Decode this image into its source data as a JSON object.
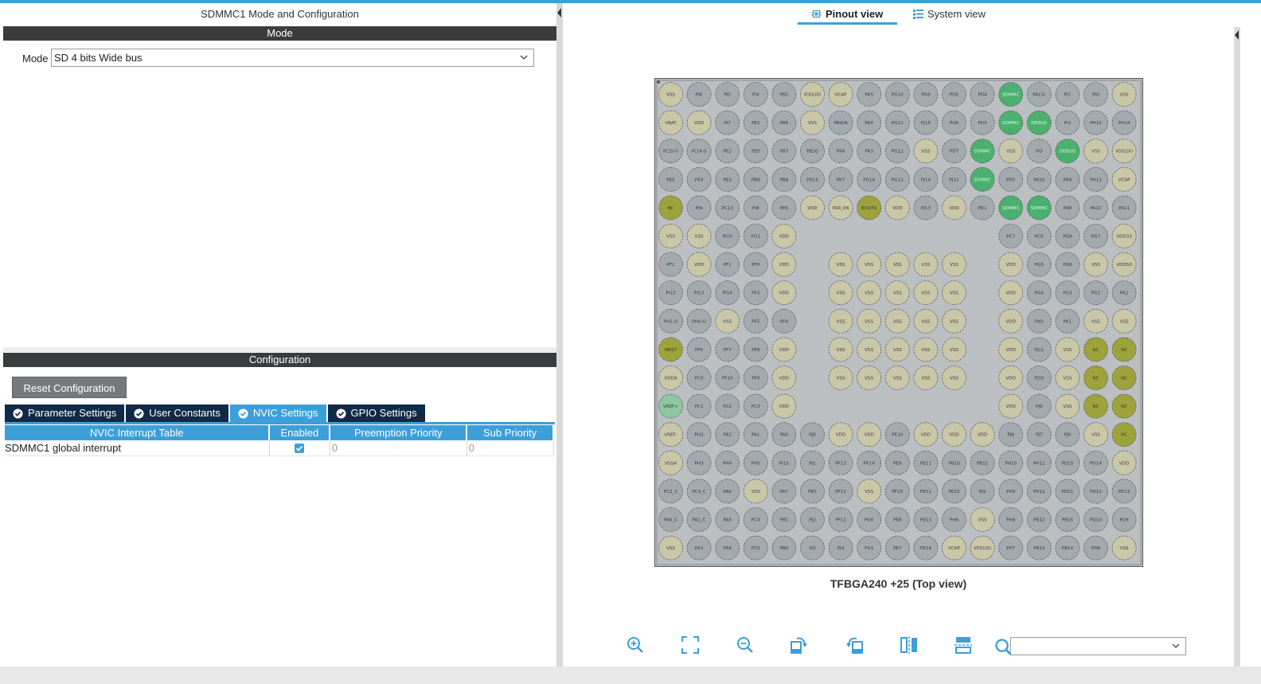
{
  "left_panel": {
    "title": "SDMMC1 Mode and Configuration",
    "mode_section": {
      "header": "Mode",
      "mode_label": "Mode",
      "mode_value": "SD 4 bits Wide bus"
    },
    "config_section": {
      "header": "Configuration",
      "reset_button": "Reset Configuration",
      "tabs": [
        {
          "label": "Parameter Settings",
          "active": false
        },
        {
          "label": "User Constants",
          "active": false
        },
        {
          "label": "NVIC Settings",
          "active": true
        },
        {
          "label": "GPIO Settings",
          "active": false
        }
      ],
      "nvic_table": {
        "columns": [
          "NVIC Interrupt Table",
          "Enabled",
          "Preemption Priority",
          "Sub Priority"
        ],
        "rows": [
          {
            "name": "SDMMC1 global interrupt",
            "enabled": true,
            "preemption": "0",
            "sub": "0"
          }
        ]
      }
    }
  },
  "right_panel": {
    "view_tabs": [
      {
        "label": "Pinout view",
        "active": true,
        "icon": "chip-icon"
      },
      {
        "label": "System view",
        "active": false,
        "icon": "list-icon"
      }
    ],
    "package_label": "TFBGA240 +25 (Top view)",
    "pin_colors": {
      "gray": "#a4a9ad",
      "power": "#c9c7a7",
      "green": "#4bb06f",
      "olive": "#9ea23a",
      "light_green": "#8fc6a0"
    },
    "pin_grid": [
      [
        [
          "VSS",
          "power"
        ],
        [
          "PI6",
          "gray"
        ],
        [
          "PI5",
          "gray"
        ],
        [
          "PI4",
          "gray"
        ],
        [
          "PB5",
          "gray"
        ],
        [
          "VDDLDO",
          "power"
        ],
        [
          "VCAP",
          "power"
        ],
        [
          "PK5",
          "gray"
        ],
        [
          "PG10",
          "gray"
        ],
        [
          "PG9",
          "gray"
        ],
        [
          "PD5",
          "gray"
        ],
        [
          "PD4",
          "gray"
        ],
        [
          "SDMMC",
          "green"
        ],
        [
          "PA15(",
          "gray"
        ],
        [
          "PI1",
          "gray"
        ],
        [
          "PI0",
          "gray"
        ],
        [
          "VSS",
          "power"
        ]
      ],
      [
        [
          "VBAT",
          "power"
        ],
        [
          "VDD",
          "power"
        ],
        [
          "PI7",
          "gray"
        ],
        [
          "PE1",
          "gray"
        ],
        [
          "PB6",
          "gray"
        ],
        [
          "VSS",
          "power"
        ],
        [
          "PB4(N",
          "gray"
        ],
        [
          "PK4",
          "gray"
        ],
        [
          "PG11",
          "gray"
        ],
        [
          "PJ15",
          "gray"
        ],
        [
          "PD6",
          "gray"
        ],
        [
          "PD3",
          "gray"
        ],
        [
          "SDMMC",
          "green"
        ],
        [
          "DEBUG",
          "green"
        ],
        [
          "PI2",
          "gray"
        ],
        [
          "PH15",
          "gray"
        ],
        [
          "PH14",
          "gray"
        ]
      ],
      [
        [
          "PC15-O",
          "gray"
        ],
        [
          "PC14-O",
          "gray"
        ],
        [
          "PE2",
          "gray"
        ],
        [
          "PE0",
          "gray"
        ],
        [
          "PB7",
          "gray"
        ],
        [
          "PB3(J",
          "gray"
        ],
        [
          "PK6",
          "gray"
        ],
        [
          "PK3",
          "gray"
        ],
        [
          "PG12",
          "gray"
        ],
        [
          "VSS",
          "power"
        ],
        [
          "PD7",
          "gray"
        ],
        [
          "SDMMC",
          "green"
        ],
        [
          "VSS",
          "power"
        ],
        [
          "PI3",
          "gray"
        ],
        [
          "DEBUG",
          "green"
        ],
        [
          "VSS",
          "power"
        ],
        [
          "VDDLDO",
          "power"
        ]
      ],
      [
        [
          "PE5",
          "gray"
        ],
        [
          "PE4",
          "gray"
        ],
        [
          "PE3",
          "gray"
        ],
        [
          "PB9",
          "gray"
        ],
        [
          "PB8",
          "gray"
        ],
        [
          "PG15",
          "gray"
        ],
        [
          "PK7",
          "gray"
        ],
        [
          "PG14",
          "gray"
        ],
        [
          "PG13",
          "gray"
        ],
        [
          "PJ14",
          "gray"
        ],
        [
          "PJ12",
          "gray"
        ],
        [
          "SDMMC",
          "green"
        ],
        [
          "PD0",
          "gray"
        ],
        [
          "PA10",
          "gray"
        ],
        [
          "PA9",
          "gray"
        ],
        [
          "PH13",
          "gray"
        ],
        [
          "VCAP",
          "power"
        ]
      ],
      [
        [
          "NC",
          "olive"
        ],
        [
          "PI9",
          "gray"
        ],
        [
          "PC13",
          "gray"
        ],
        [
          "PI8",
          "gray"
        ],
        [
          "PE6",
          "gray"
        ],
        [
          "VDD",
          "power"
        ],
        [
          "PDR_ON",
          "power"
        ],
        [
          "BOOT0",
          "olive"
        ],
        [
          "VDD",
          "power"
        ],
        [
          "PJ13",
          "gray"
        ],
        [
          "VDD",
          "power"
        ],
        [
          "PD1",
          "gray"
        ],
        [
          "SDMMC",
          "green"
        ],
        [
          "SDMMC",
          "green"
        ],
        [
          "PA8",
          "gray"
        ],
        [
          "PA12",
          "gray"
        ],
        [
          "PA11",
          "gray"
        ]
      ],
      [
        [
          "VSS",
          "power"
        ],
        [
          "VSS",
          "power"
        ],
        [
          "PI10",
          "gray"
        ],
        [
          "PI11",
          "gray"
        ],
        [
          "VDD",
          "power"
        ],
        null,
        null,
        null,
        null,
        null,
        null,
        null,
        [
          "PC7",
          "gray"
        ],
        [
          "PC6",
          "gray"
        ],
        [
          "PG8",
          "gray"
        ],
        [
          "PG7",
          "gray"
        ],
        [
          "VDD33",
          "power"
        ]
      ],
      [
        [
          "PF2",
          "gray"
        ],
        [
          "VDD",
          "power"
        ],
        [
          "PF1",
          "gray"
        ],
        [
          "PF0",
          "gray"
        ],
        [
          "VDD",
          "power"
        ],
        null,
        [
          "VSS",
          "power"
        ],
        [
          "VSS",
          "power"
        ],
        [
          "VSS",
          "power"
        ],
        [
          "VSS",
          "power"
        ],
        [
          "VSS",
          "power"
        ],
        null,
        [
          "VDD",
          "power"
        ],
        [
          "PG5",
          "gray"
        ],
        [
          "PG6",
          "gray"
        ],
        [
          "VSS",
          "power"
        ],
        [
          "VDD50",
          "power"
        ]
      ],
      [
        [
          "PI12",
          "gray"
        ],
        [
          "PI13",
          "gray"
        ],
        [
          "PI14",
          "gray"
        ],
        [
          "PF3",
          "gray"
        ],
        [
          "VDD",
          "power"
        ],
        null,
        [
          "VSS",
          "power"
        ],
        [
          "VSS",
          "power"
        ],
        [
          "VSS",
          "power"
        ],
        [
          "VSS",
          "power"
        ],
        [
          "VSS",
          "power"
        ],
        null,
        [
          "VDD",
          "power"
        ],
        [
          "PG4",
          "gray"
        ],
        [
          "PG3",
          "gray"
        ],
        [
          "PG2",
          "gray"
        ],
        [
          "PK2",
          "gray"
        ]
      ],
      [
        [
          "PH1-O",
          "gray"
        ],
        [
          "PH0-O",
          "gray"
        ],
        [
          "VSS",
          "power"
        ],
        [
          "PF5",
          "gray"
        ],
        [
          "PF4",
          "gray"
        ],
        null,
        [
          "VSS",
          "power"
        ],
        [
          "VSS",
          "power"
        ],
        [
          "VSS",
          "power"
        ],
        [
          "VSS",
          "power"
        ],
        [
          "VSS",
          "power"
        ],
        null,
        [
          "VDD",
          "power"
        ],
        [
          "PK0",
          "gray"
        ],
        [
          "PK1",
          "gray"
        ],
        [
          "VSS",
          "power"
        ],
        [
          "VSS",
          "power"
        ]
      ],
      [
        [
          "NRST",
          "olive"
        ],
        [
          "PF6",
          "gray"
        ],
        [
          "PF7",
          "gray"
        ],
        [
          "PF8",
          "gray"
        ],
        [
          "VDD",
          "power"
        ],
        null,
        [
          "VSS",
          "power"
        ],
        [
          "VSS",
          "power"
        ],
        [
          "VSS",
          "power"
        ],
        [
          "VSS",
          "power"
        ],
        [
          "VSS",
          "power"
        ],
        null,
        [
          "VDD",
          "power"
        ],
        [
          "PJ11",
          "gray"
        ],
        [
          "VSS",
          "power"
        ],
        [
          "NC",
          "olive"
        ],
        [
          "NC",
          "olive"
        ]
      ],
      [
        [
          "VDDA",
          "power"
        ],
        [
          "PC0",
          "gray"
        ],
        [
          "PF10",
          "gray"
        ],
        [
          "PF9",
          "gray"
        ],
        [
          "VDD",
          "power"
        ],
        null,
        [
          "VSS",
          "power"
        ],
        [
          "VSS",
          "power"
        ],
        [
          "VSS",
          "power"
        ],
        [
          "VSS",
          "power"
        ],
        [
          "VSS",
          "power"
        ],
        null,
        [
          "VDD",
          "power"
        ],
        [
          "PJ10",
          "gray"
        ],
        [
          "VSS",
          "power"
        ],
        [
          "NC",
          "olive"
        ],
        [
          "NC",
          "olive"
        ]
      ],
      [
        [
          "VREF+",
          "light_green"
        ],
        [
          "PC1",
          "gray"
        ],
        [
          "PC2",
          "gray"
        ],
        [
          "PC3",
          "gray"
        ],
        [
          "VDD",
          "power"
        ],
        null,
        null,
        null,
        null,
        null,
        null,
        null,
        [
          "VDD",
          "power"
        ],
        [
          "PJ9",
          "gray"
        ],
        [
          "VSS",
          "power"
        ],
        [
          "NC",
          "olive"
        ],
        [
          "NC",
          "olive"
        ]
      ],
      [
        [
          "VREF-",
          "power"
        ],
        [
          "PH2",
          "gray"
        ],
        [
          "PA2",
          "gray"
        ],
        [
          "PA1",
          "gray"
        ],
        [
          "PA0",
          "gray"
        ],
        [
          "PJ0",
          "gray"
        ],
        [
          "VDD",
          "power"
        ],
        [
          "VDD",
          "power"
        ],
        [
          "PE10",
          "gray"
        ],
        [
          "VDD",
          "power"
        ],
        [
          "VDD",
          "power"
        ],
        [
          "VDD",
          "power"
        ],
        [
          "PJ8",
          "gray"
        ],
        [
          "PJ7",
          "gray"
        ],
        [
          "PJ6",
          "gray"
        ],
        [
          "VSS",
          "power"
        ],
        [
          "NC",
          "olive"
        ]
      ],
      [
        [
          "VSSA",
          "power"
        ],
        [
          "PH3",
          "gray"
        ],
        [
          "PH4",
          "gray"
        ],
        [
          "PH5",
          "gray"
        ],
        [
          "PI15",
          "gray"
        ],
        [
          "PJ1",
          "gray"
        ],
        [
          "PF13",
          "gray"
        ],
        [
          "PF14",
          "gray"
        ],
        [
          "PE9",
          "gray"
        ],
        [
          "PE11",
          "gray"
        ],
        [
          "PB10",
          "gray"
        ],
        [
          "PB11",
          "gray"
        ],
        [
          "PH10",
          "gray"
        ],
        [
          "PH11",
          "gray"
        ],
        [
          "PD15",
          "gray"
        ],
        [
          "PD14",
          "gray"
        ],
        [
          "VDD",
          "power"
        ]
      ],
      [
        [
          "PC2_C",
          "gray"
        ],
        [
          "PC3_C",
          "gray"
        ],
        [
          "PA6",
          "gray"
        ],
        [
          "VSS",
          "power"
        ],
        [
          "PA7",
          "gray"
        ],
        [
          "PB2",
          "gray"
        ],
        [
          "PF12",
          "gray"
        ],
        [
          "VSS",
          "power"
        ],
        [
          "PF15",
          "gray"
        ],
        [
          "PE12",
          "gray"
        ],
        [
          "PE15",
          "gray"
        ],
        [
          "PJ5",
          "gray"
        ],
        [
          "PH9",
          "gray"
        ],
        [
          "PH12",
          "gray"
        ],
        [
          "PD11",
          "gray"
        ],
        [
          "PD12",
          "gray"
        ],
        [
          "PD13",
          "gray"
        ]
      ],
      [
        [
          "PA0_C",
          "gray"
        ],
        [
          "PA1_C",
          "gray"
        ],
        [
          "PA5",
          "gray"
        ],
        [
          "PC4",
          "gray"
        ],
        [
          "PB1",
          "gray"
        ],
        [
          "PJ2",
          "gray"
        ],
        [
          "PF11",
          "gray"
        ],
        [
          "PG0",
          "gray"
        ],
        [
          "PE8",
          "gray"
        ],
        [
          "PE13",
          "gray"
        ],
        [
          "PH6",
          "gray"
        ],
        [
          "VSS",
          "power"
        ],
        [
          "PH8",
          "gray"
        ],
        [
          "PB12",
          "gray"
        ],
        [
          "PB15",
          "gray"
        ],
        [
          "PD10",
          "gray"
        ],
        [
          "PD9",
          "gray"
        ]
      ],
      [
        [
          "VSS",
          "power"
        ],
        [
          "PA3",
          "gray"
        ],
        [
          "PA4",
          "gray"
        ],
        [
          "PC5",
          "gray"
        ],
        [
          "PB0",
          "gray"
        ],
        [
          "PJ3",
          "gray"
        ],
        [
          "PJ4",
          "gray"
        ],
        [
          "PG1",
          "gray"
        ],
        [
          "PE7",
          "gray"
        ],
        [
          "PE14",
          "gray"
        ],
        [
          "VCAP",
          "power"
        ],
        [
          "VDDLDO",
          "power"
        ],
        [
          "PH7",
          "gray"
        ],
        [
          "PB13",
          "gray"
        ],
        [
          "PB14",
          "gray"
        ],
        [
          "PD8",
          "gray"
        ],
        [
          "VSS",
          "power"
        ]
      ]
    ],
    "toolbar": [
      {
        "name": "zoom-in-button",
        "icon": "zoom-in-icon"
      },
      {
        "name": "fit-screen-button",
        "icon": "fit-screen-icon"
      },
      {
        "name": "zoom-out-button",
        "icon": "zoom-out-icon"
      },
      {
        "name": "rotate-right-button",
        "icon": "rotate-right-icon"
      },
      {
        "name": "rotate-left-button",
        "icon": "rotate-left-icon"
      },
      {
        "name": "flip-vertical-button",
        "icon": "flip-vertical-icon"
      },
      {
        "name": "flip-horizontal-button",
        "icon": "flip-horizontal-icon"
      }
    ],
    "search": {
      "value": ""
    }
  }
}
